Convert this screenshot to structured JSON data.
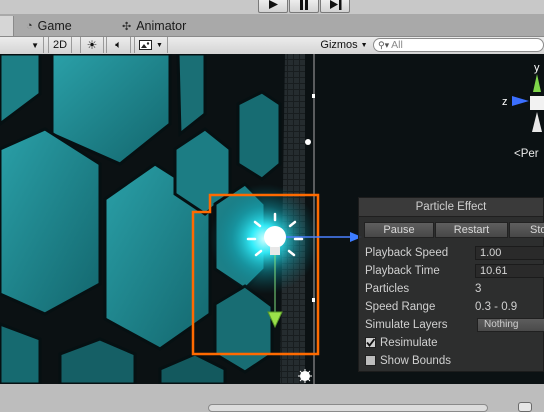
{
  "toolbar": {
    "play_icon": "play-icon",
    "pause_icon": "pause-icon",
    "step_icon": "step-icon"
  },
  "tabs": [
    {
      "label": "Game",
      "icon": "game-icon"
    },
    {
      "label": "Animator",
      "icon": "animator-icon"
    }
  ],
  "scene_toolbar": {
    "mode_2d": "2D",
    "gizmos": "Gizmos",
    "search_placeholder": "All"
  },
  "scene": {
    "persp_label": "Per",
    "gizmo_axis_labels": {
      "y": "y",
      "z": "z"
    },
    "colors": {
      "hex_fill": "#1f8a91",
      "selection": "#ff6a00",
      "glow": "#33f2ff"
    }
  },
  "particle_panel": {
    "title": "Particle Effect",
    "buttons": {
      "pause": "Pause",
      "restart": "Restart",
      "stop": "Stop"
    },
    "fields": {
      "playback_speed": {
        "label": "Playback Speed",
        "value": "1.00"
      },
      "playback_time": {
        "label": "Playback Time",
        "value": "10.61"
      },
      "particles": {
        "label": "Particles",
        "value": "3"
      },
      "speed_range": {
        "label": "Speed Range",
        "value": "0.3 - 0.9"
      },
      "simulate_layers": {
        "label": "Simulate Layers",
        "value": "Nothing"
      }
    },
    "resimulate": {
      "label": "Resimulate",
      "checked": true
    },
    "show_bounds": {
      "label": "Show Bounds",
      "checked": false
    }
  }
}
